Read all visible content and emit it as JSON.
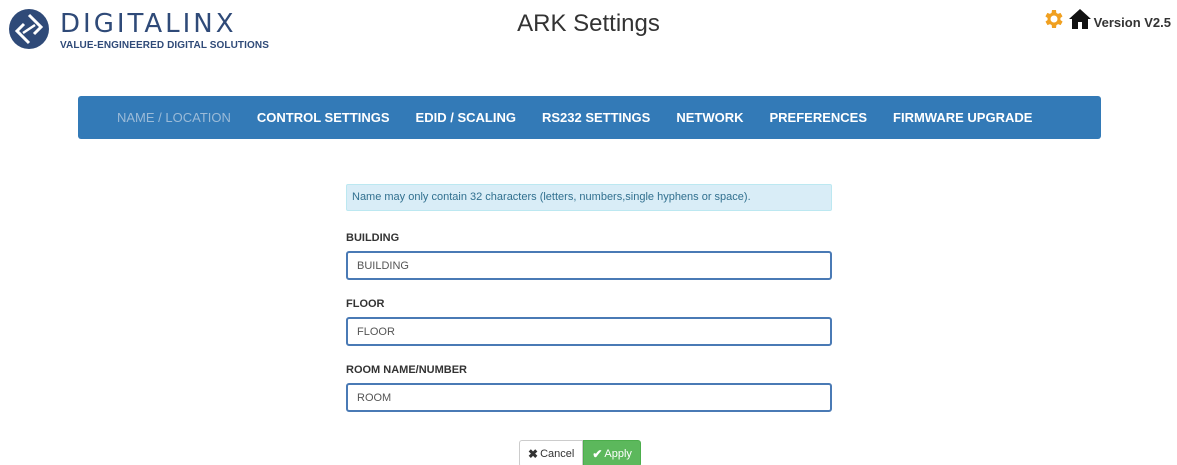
{
  "brand": {
    "name": "DIGITALINX",
    "tagline": "VALUE-ENGINEERED DIGITAL SOLUTIONS",
    "color": "#2f4a78"
  },
  "header": {
    "title": "ARK Settings",
    "version": "Version V2.5"
  },
  "icons": {
    "settings": "gear-icon",
    "home": "home-icon",
    "settings_color": "#f0a020"
  },
  "nav": {
    "color": "#337ab7",
    "active": "NAME / LOCATION",
    "items": [
      "NAME / LOCATION",
      "CONTROL SETTINGS",
      "EDID / SCALING",
      "RS232 SETTINGS",
      "NETWORK",
      "PREFERENCES",
      "FIRMWARE UPGRADE"
    ]
  },
  "form": {
    "notice": "Name may only contain 32 characters (letters, numbers,single hyphens or space).",
    "building": {
      "label": "BUILDING",
      "value": "BUILDING"
    },
    "floor": {
      "label": "FLOOR",
      "value": "FLOOR"
    },
    "room": {
      "label": "ROOM NAME/NUMBER",
      "value": "ROOM"
    }
  },
  "actions": {
    "cancel": "Cancel",
    "apply": "Apply",
    "apply_color": "#5cb85c"
  }
}
